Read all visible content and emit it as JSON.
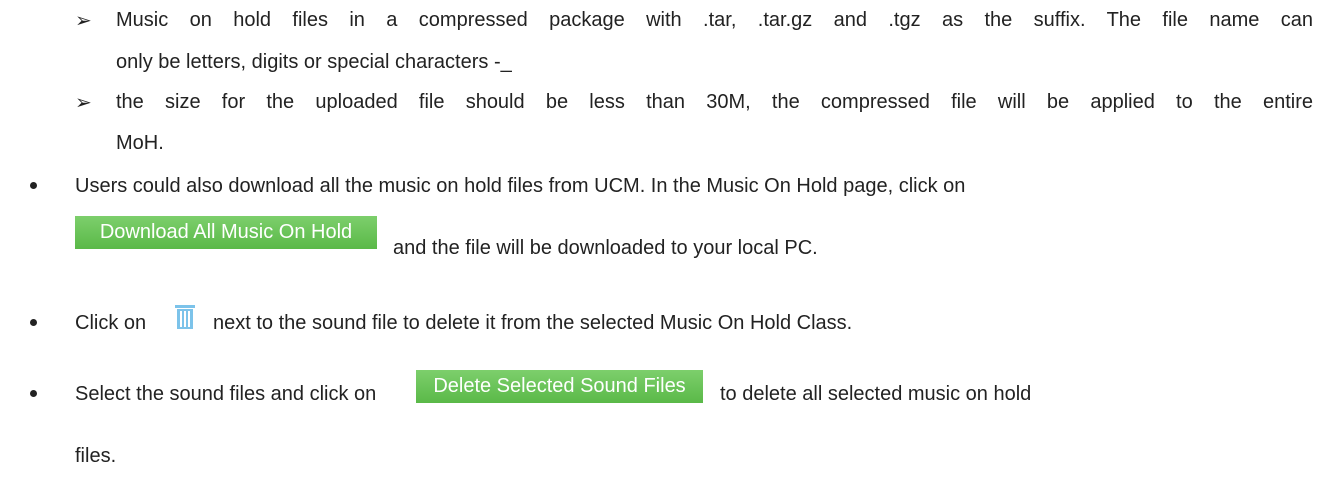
{
  "sub_items": [
    {
      "line1": "Music on hold files in a compressed package with .tar, .tar.gz and .tgz as the suffix. The file name can",
      "line2": "only be letters, digits or special characters -_"
    },
    {
      "line1": "the size for the uploaded file should be less than 30M, the compressed file will be applied to the entire",
      "line2": "MoH."
    }
  ],
  "download_item": {
    "text_before": "Users could also download all the music on hold files from UCM. In the Music On Hold page, click on",
    "button_label": "Download All Music On Hold",
    "text_after": "and the file will be downloaded to your local PC."
  },
  "delete_item": {
    "text_before": "Click on",
    "icon": "trash-icon",
    "text_after": "next to the sound file to delete it from the selected Music On Hold Class."
  },
  "delete_selected_item": {
    "text_before": "Select the sound files and click on",
    "button_label": "Delete Selected Sound Files",
    "text_after": "to delete all selected music on hold",
    "text_line2": "files."
  },
  "colors": {
    "button_green": "#5ab948",
    "icon_blue": "#7cc3ea"
  }
}
